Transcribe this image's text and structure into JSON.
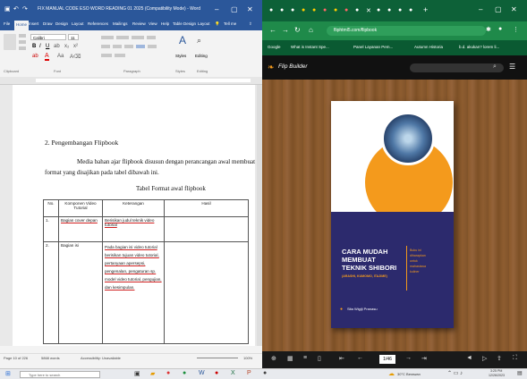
{
  "word": {
    "title": "FIX MANUAL CODE ESO WORD READING 01 2025 (Compatibility Mode) - Word",
    "tabs": [
      "File",
      "Home",
      "Insert",
      "Draw",
      "Design",
      "Layout",
      "References",
      "Mailings",
      "Review",
      "View",
      "Help",
      "Table Design",
      "Layout",
      "Tell me"
    ],
    "ribbon": {
      "font_name": "Calibri",
      "font_size": "11",
      "groups": [
        "Clipboard",
        "Font",
        "Paragraph",
        "Styles",
        "Editing"
      ],
      "styles_label": "Styles",
      "editing_label": "Editing"
    },
    "document": {
      "heading": "2. Pengembangan Flipbook",
      "para_line1": "Media bahan ajar flipbook disusun dengan perancangan awal membuat",
      "para_line2": "format yang disajikan pada tabel dibawah ini.",
      "table_caption": "Tabel Format awal flipbook",
      "table": {
        "headers": [
          "No.",
          "Komponen Video Tutorial",
          "Keterangan",
          "Hasil"
        ],
        "rows": [
          {
            "no": "1.",
            "komponen": "Bagian cover depan",
            "keterangan": "Berisikan judul teknik video tutorial"
          },
          {
            "no": "2.",
            "komponen": "Bagian isi",
            "keterangan": "Pada bagian isi video tutorial berisikan tujuan video tutorial, pertanyaan apersepsi, pengenalan, pengaturan sp. model video tutorial, pengujian, dan kesimpulan."
          }
        ]
      }
    },
    "status": {
      "page": "Page 10 of 226",
      "words": "5868 words",
      "accessibility": "Accessibility: Unavailable",
      "zoom": "100%"
    }
  },
  "browser": {
    "url": "fliphtml5.com/flipbook",
    "bookmarks": [
      "Google",
      "What is Instant Spe...",
      "Panel Layanan Pem...",
      "Autumn Historia",
      "b.d. akukan? lorem li..."
    ],
    "flipbook": {
      "brand": "Flip Builder",
      "page_number": "1/46",
      "cover": {
        "title_line1": "CARA MUDAH",
        "title_line2": "MEMBUAT",
        "title_line3": "TEKNIK SHIBORI",
        "subtitle": "(ARASHI, KUMOMO, ITAJIME)",
        "side_text": [
          "Buku ini",
          "diharapkan",
          "untuk",
          "mahasiswa",
          "kuliner"
        ],
        "author": "Sita Wigiji Pranasu"
      },
      "colors": {
        "cover_bg": "#2c2a6d",
        "accent": "#f49a1c"
      }
    }
  },
  "taskbar": {
    "search_placeholder": "Type here to search",
    "weather": "30°C Berawan",
    "time": "3:25 PM",
    "date": "12/26/2023"
  }
}
